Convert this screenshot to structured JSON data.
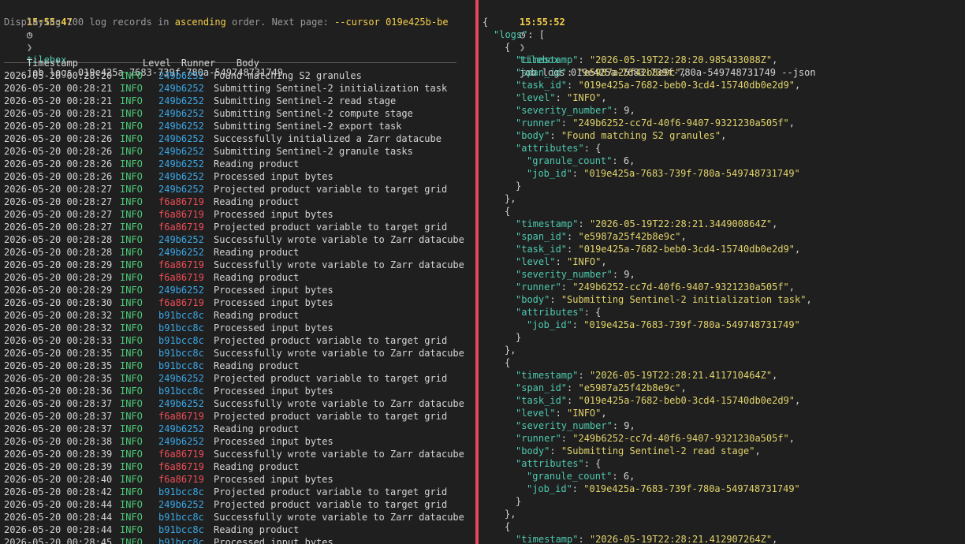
{
  "left": {
    "prompt": {
      "time": "15:55:47",
      "clock_icon": "clock-icon",
      "arrow": "❯",
      "program": "tilebox",
      "args": "job logs 019e425a-7683-739f-780a-549748731749"
    },
    "summary": {
      "prefix": "Displaying 100 log records in ",
      "order": "ascending",
      "middle": " order. Next page: ",
      "cursor": "--cursor 019e425b-be"
    },
    "columns": {
      "timestamp": "Timestamp",
      "level": "Level",
      "runner": "Runner",
      "body": "Body"
    },
    "rows": [
      {
        "ts": "2026-05-20 00:28:20",
        "level": "INFO",
        "runner": "249b6252",
        "body": "Found matching S2 granules"
      },
      {
        "ts": "2026-05-20 00:28:21",
        "level": "INFO",
        "runner": "249b6252",
        "body": "Submitting Sentinel-2 initialization task"
      },
      {
        "ts": "2026-05-20 00:28:21",
        "level": "INFO",
        "runner": "249b6252",
        "body": "Submitting Sentinel-2 read stage"
      },
      {
        "ts": "2026-05-20 00:28:21",
        "level": "INFO",
        "runner": "249b6252",
        "body": "Submitting Sentinel-2 compute stage"
      },
      {
        "ts": "2026-05-20 00:28:21",
        "level": "INFO",
        "runner": "249b6252",
        "body": "Submitting Sentinel-2 export task"
      },
      {
        "ts": "2026-05-20 00:28:26",
        "level": "INFO",
        "runner": "249b6252",
        "body": "Successfully initialized a Zarr datacube"
      },
      {
        "ts": "2026-05-20 00:28:26",
        "level": "INFO",
        "runner": "249b6252",
        "body": "Submitting Sentinel-2 granule tasks"
      },
      {
        "ts": "2026-05-20 00:28:26",
        "level": "INFO",
        "runner": "249b6252",
        "body": "Reading product"
      },
      {
        "ts": "2026-05-20 00:28:26",
        "level": "INFO",
        "runner": "249b6252",
        "body": "Processed input bytes"
      },
      {
        "ts": "2026-05-20 00:28:27",
        "level": "INFO",
        "runner": "249b6252",
        "body": "Projected product variable to target grid"
      },
      {
        "ts": "2026-05-20 00:28:27",
        "level": "INFO",
        "runner": "f6a86719",
        "body": "Reading product"
      },
      {
        "ts": "2026-05-20 00:28:27",
        "level": "INFO",
        "runner": "f6a86719",
        "body": "Processed input bytes"
      },
      {
        "ts": "2026-05-20 00:28:27",
        "level": "INFO",
        "runner": "f6a86719",
        "body": "Projected product variable to target grid"
      },
      {
        "ts": "2026-05-20 00:28:28",
        "level": "INFO",
        "runner": "249b6252",
        "body": "Successfully wrote variable to Zarr datacube"
      },
      {
        "ts": "2026-05-20 00:28:28",
        "level": "INFO",
        "runner": "249b6252",
        "body": "Reading product"
      },
      {
        "ts": "2026-05-20 00:28:29",
        "level": "INFO",
        "runner": "f6a86719",
        "body": "Successfully wrote variable to Zarr datacube"
      },
      {
        "ts": "2026-05-20 00:28:29",
        "level": "INFO",
        "runner": "f6a86719",
        "body": "Reading product"
      },
      {
        "ts": "2026-05-20 00:28:29",
        "level": "INFO",
        "runner": "249b6252",
        "body": "Processed input bytes"
      },
      {
        "ts": "2026-05-20 00:28:30",
        "level": "INFO",
        "runner": "f6a86719",
        "body": "Processed input bytes"
      },
      {
        "ts": "2026-05-20 00:28:32",
        "level": "INFO",
        "runner": "b91bcc8c",
        "body": "Reading product"
      },
      {
        "ts": "2026-05-20 00:28:32",
        "level": "INFO",
        "runner": "b91bcc8c",
        "body": "Processed input bytes"
      },
      {
        "ts": "2026-05-20 00:28:33",
        "level": "INFO",
        "runner": "b91bcc8c",
        "body": "Projected product variable to target grid"
      },
      {
        "ts": "2026-05-20 00:28:35",
        "level": "INFO",
        "runner": "b91bcc8c",
        "body": "Successfully wrote variable to Zarr datacube"
      },
      {
        "ts": "2026-05-20 00:28:35",
        "level": "INFO",
        "runner": "b91bcc8c",
        "body": "Reading product"
      },
      {
        "ts": "2026-05-20 00:28:35",
        "level": "INFO",
        "runner": "249b6252",
        "body": "Projected product variable to target grid"
      },
      {
        "ts": "2026-05-20 00:28:36",
        "level": "INFO",
        "runner": "b91bcc8c",
        "body": "Processed input bytes"
      },
      {
        "ts": "2026-05-20 00:28:37",
        "level": "INFO",
        "runner": "249b6252",
        "body": "Successfully wrote variable to Zarr datacube"
      },
      {
        "ts": "2026-05-20 00:28:37",
        "level": "INFO",
        "runner": "f6a86719",
        "body": "Projected product variable to target grid"
      },
      {
        "ts": "2026-05-20 00:28:37",
        "level": "INFO",
        "runner": "249b6252",
        "body": "Reading product"
      },
      {
        "ts": "2026-05-20 00:28:38",
        "level": "INFO",
        "runner": "249b6252",
        "body": "Processed input bytes"
      },
      {
        "ts": "2026-05-20 00:28:39",
        "level": "INFO",
        "runner": "f6a86719",
        "body": "Successfully wrote variable to Zarr datacube"
      },
      {
        "ts": "2026-05-20 00:28:39",
        "level": "INFO",
        "runner": "f6a86719",
        "body": "Reading product"
      },
      {
        "ts": "2026-05-20 00:28:40",
        "level": "INFO",
        "runner": "f6a86719",
        "body": "Processed input bytes"
      },
      {
        "ts": "2026-05-20 00:28:42",
        "level": "INFO",
        "runner": "b91bcc8c",
        "body": "Projected product variable to target grid"
      },
      {
        "ts": "2026-05-20 00:28:44",
        "level": "INFO",
        "runner": "249b6252",
        "body": "Projected product variable to target grid"
      },
      {
        "ts": "2026-05-20 00:28:44",
        "level": "INFO",
        "runner": "b91bcc8c",
        "body": "Successfully wrote variable to Zarr datacube"
      },
      {
        "ts": "2026-05-20 00:28:44",
        "level": "INFO",
        "runner": "b91bcc8c",
        "body": "Reading product"
      },
      {
        "ts": "2026-05-20 00:28:45",
        "level": "INFO",
        "runner": "b91bcc8c",
        "body": "Processed input bytes"
      }
    ]
  },
  "right": {
    "prompt": {
      "time": "15:55:52",
      "clock_icon": "clock-icon",
      "arrow": "❯",
      "program": "tilebox",
      "args": "job logs 019e425a-7683-739f-780a-549748731749 --json"
    },
    "logs_key": "\"logs\"",
    "records": [
      {
        "timestamp": "\"2026-05-19T22:28:20.985433088Z\"",
        "span_id": "\"e5987a25f42b8e9c\"",
        "task_id": "\"019e425a-7682-beb0-3cd4-15740db0e2d9\"",
        "level": "\"INFO\"",
        "severity_number": "9",
        "runner": "\"249b6252-cc7d-40f6-9407-9321230a505f\"",
        "body": "\"Found matching S2 granules\"",
        "attributes": [
          {
            "key": "\"granule_count\"",
            "value": "6",
            "type": "num"
          },
          {
            "key": "\"job_id\"",
            "value": "\"019e425a-7683-739f-780a-549748731749\"",
            "type": "str"
          }
        ]
      },
      {
        "timestamp": "\"2026-05-19T22:28:21.344900864Z\"",
        "span_id": "\"e5987a25f42b8e9c\"",
        "task_id": "\"019e425a-7682-beb0-3cd4-15740db0e2d9\"",
        "level": "\"INFO\"",
        "severity_number": "9",
        "runner": "\"249b6252-cc7d-40f6-9407-9321230a505f\"",
        "body": "\"Submitting Sentinel-2 initialization task\"",
        "attributes": [
          {
            "key": "\"job_id\"",
            "value": "\"019e425a-7683-739f-780a-549748731749\"",
            "type": "str"
          }
        ]
      },
      {
        "timestamp": "\"2026-05-19T22:28:21.411710464Z\"",
        "span_id": "\"e5987a25f42b8e9c\"",
        "task_id": "\"019e425a-7682-beb0-3cd4-15740db0e2d9\"",
        "level": "\"INFO\"",
        "severity_number": "9",
        "runner": "\"249b6252-cc7d-40f6-9407-9321230a505f\"",
        "body": "\"Submitting Sentinel-2 read stage\"",
        "attributes": [
          {
            "key": "\"granule_count\"",
            "value": "6",
            "type": "num"
          },
          {
            "key": "\"job_id\"",
            "value": "\"019e425a-7683-739f-780a-549748731749\"",
            "type": "str"
          }
        ]
      }
    ],
    "partial_timestamp": "\"2026-05-19T22:28:21.412907264Z\""
  },
  "colors": {
    "runner_249b6252": "#3aa7e6",
    "runner_b91bcc8c": "#3aa7e6",
    "runner_f6a86719": "#ef4d57",
    "level_info": "#4ec97a",
    "divider": "#e8475a"
  }
}
